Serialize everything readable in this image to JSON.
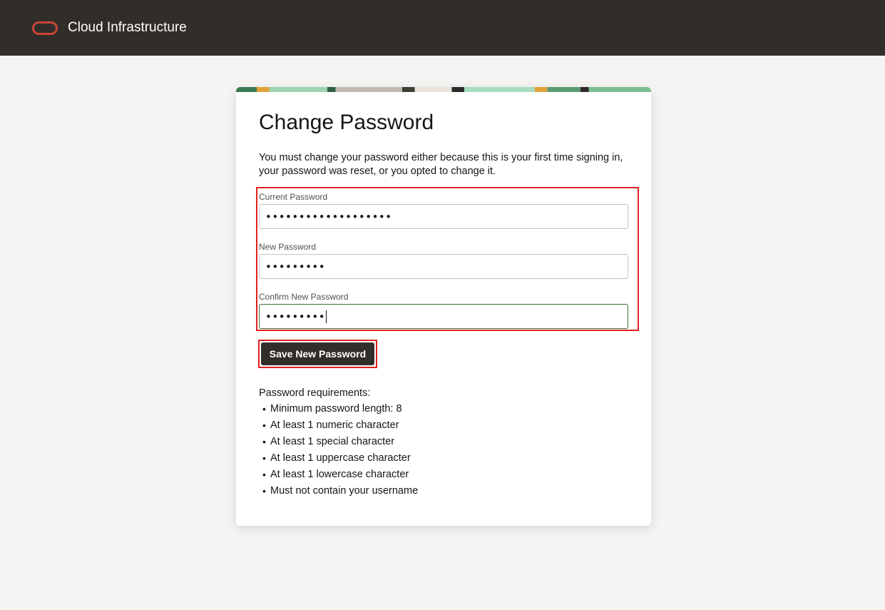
{
  "header": {
    "brand": "Cloud Infrastructure",
    "logo_icon": "oracle-logo-icon",
    "background_color": "#312d2a",
    "logo_color": "#c74634"
  },
  "form": {
    "title": "Change Password",
    "intro": "You must change your password either because this is your first time signing in, your password was reset, or you opted to change it.",
    "current_password": {
      "label": "Current Password",
      "value": "•••••••••••••••••••"
    },
    "new_password": {
      "label": "New Password",
      "value": "•••••••••"
    },
    "confirm_password": {
      "label": "Confirm New Password",
      "value": "•••••••••"
    },
    "save_label": "Save New Password",
    "highlight_color": "#e0201f"
  },
  "requirements": {
    "heading": "Password requirements:",
    "items": [
      "Minimum password length: 8",
      "At least 1 numeric character",
      "At least 1 special character",
      "At least 1 uppercase character",
      "At least 1 lowercase character",
      "Must not contain your username"
    ]
  }
}
